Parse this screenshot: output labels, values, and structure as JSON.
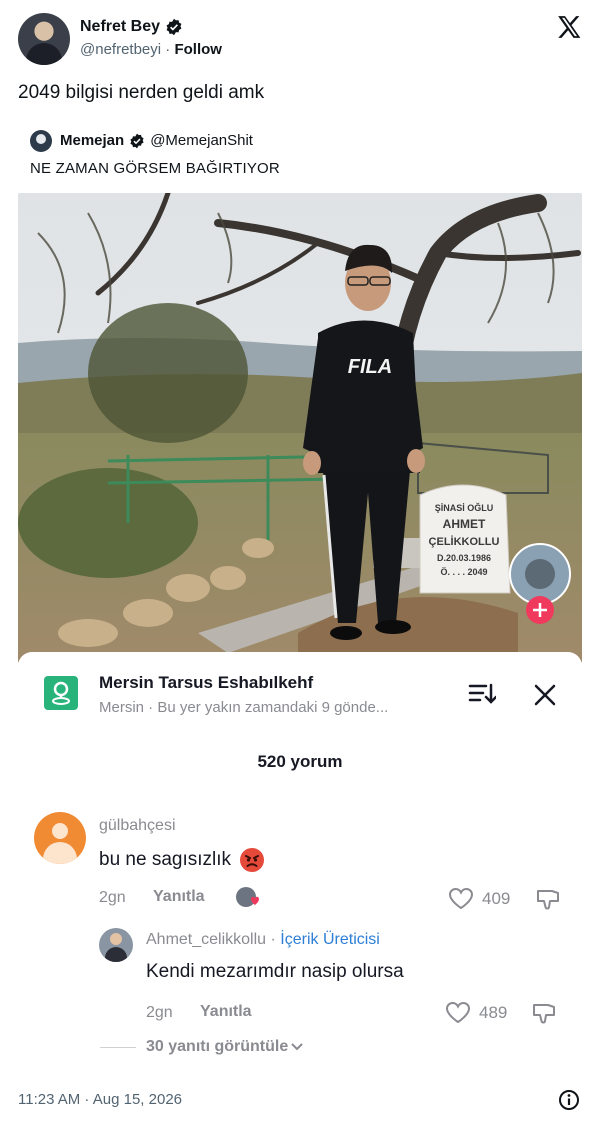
{
  "author": {
    "name": "Nefret Bey",
    "handle": "@nefretbeyi",
    "separator": "·",
    "follow_label": "Follow",
    "verified": true
  },
  "tweet": {
    "text": "2049 bilgisi nerden geldi amk"
  },
  "quote": {
    "name": "Memejan",
    "handle": "@MemejanShit",
    "text": "NE ZAMAN GÖRSEM BAĞIRTIYOR"
  },
  "photo": {
    "shirt_logo": "FILA",
    "headstone_lines": [
      "ŞİNASİ OĞLU",
      "AHMET",
      "ÇELİKKOLLU",
      "D.20.03.1986",
      "Ö. . . . 2049"
    ]
  },
  "sheet": {
    "location_title": "Mersin Tarsus Eshabılkehf",
    "location_subtitle": "Mersin · Bu yer yakın zamandaki 9 gönde...",
    "comment_count": "520 yorum"
  },
  "comments": [
    {
      "username": "gülbahçesi",
      "text": "bu ne sagısızlık",
      "date": "2gn",
      "reply_label": "Yanıtla",
      "likes": "409"
    }
  ],
  "reply": {
    "username": "Ahmet_celikkollu",
    "separator": "·",
    "badge": "İçerik Üreticisi",
    "text": "Kendi mezarımdır nasip olursa",
    "date": "2gn",
    "reply_label": "Yanıtla",
    "likes": "489",
    "view_replies": "30 yanıtı görüntüle"
  },
  "footer": {
    "timestamp": "11:23 AM · Aug 15, 2026"
  },
  "colors": {
    "verified_badge": "#0f1419",
    "location_icon": "#27b37a",
    "creator_badge": "#2e7fd6",
    "add_button": "#ef3a5d",
    "avatar_comment": "#f08a33"
  },
  "icons": [
    "verified-icon",
    "x-logo-icon",
    "location-pin-icon",
    "sort-icon",
    "close-icon",
    "heart-icon",
    "dislike-icon",
    "chevron-down-icon",
    "info-icon",
    "plus-icon"
  ]
}
